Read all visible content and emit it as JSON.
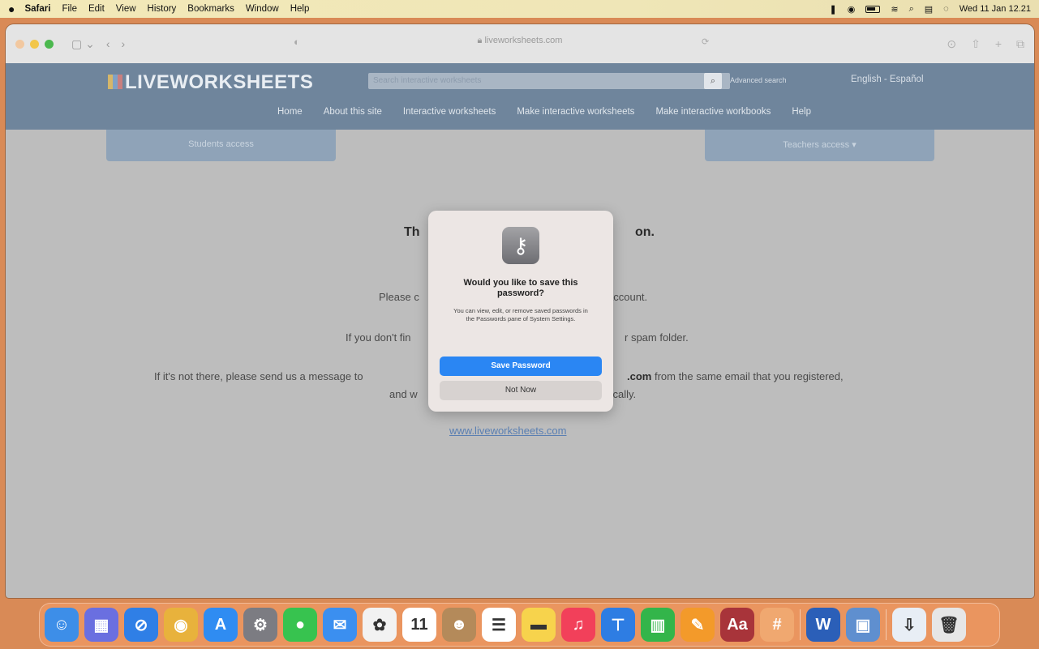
{
  "menubar": {
    "apple": "",
    "items": [
      "Safari",
      "File",
      "Edit",
      "View",
      "History",
      "Bookmarks",
      "Window",
      "Help"
    ],
    "clock": "Wed 11 Jan  12.21"
  },
  "browser": {
    "url": "liveworksheets.com"
  },
  "site": {
    "logo": "LIVEWORKSHEETS",
    "search_placeholder": "Search interactive worksheets",
    "advanced_search": "Advanced search",
    "language": "English - Español",
    "nav": [
      "Home",
      "About this site",
      "Interactive worksheets",
      "Make interactive worksheets",
      "Make interactive workbooks",
      "Help"
    ],
    "students_access": "Students access",
    "teachers_access": "Teachers access ▾"
  },
  "page": {
    "heading_start": "Th",
    "heading_end": "on.",
    "line1_start": "Please c",
    "line1_end": "account.",
    "line2_start": "If you don't fin",
    "line2_end": "r spam folder.",
    "line3_start": "If it's not there, please send us a message to",
    "line3_end_bold": ".com",
    "line3_end": " from the same email that you registered,",
    "line4_start": "and w",
    "line4_end": "tically.",
    "site_link": "www.liveworksheets.com"
  },
  "dialog": {
    "title": "Would you like to save this password?",
    "body": "You can view, edit, or remove saved passwords in the Passwords pane of System Settings.",
    "save_button": "Save Password",
    "not_now_button": "Not Now"
  },
  "dock": {
    "apps": [
      {
        "name": "finder",
        "color": "#3d8ee8",
        "glyph": "☺"
      },
      {
        "name": "launchpad",
        "color": "#6a6fe0",
        "glyph": "▦"
      },
      {
        "name": "safari",
        "color": "#2f7fe6",
        "glyph": "⊘"
      },
      {
        "name": "chrome",
        "color": "#e8b23c",
        "glyph": "◉"
      },
      {
        "name": "app-store",
        "color": "#2f8cf2",
        "glyph": "A"
      },
      {
        "name": "system-settings",
        "color": "#7c7c82",
        "glyph": "⚙"
      },
      {
        "name": "messages",
        "color": "#37c34f",
        "glyph": "●"
      },
      {
        "name": "mail",
        "color": "#3b8ff0",
        "glyph": "✉"
      },
      {
        "name": "photos",
        "color": "#f2f2f2",
        "glyph": "✿"
      },
      {
        "name": "calendar",
        "color": "#ffffff",
        "glyph": "11"
      },
      {
        "name": "contacts",
        "color": "#b48a5a",
        "glyph": "☻"
      },
      {
        "name": "reminders",
        "color": "#ffffff",
        "glyph": "☰"
      },
      {
        "name": "notes",
        "color": "#f7d34c",
        "glyph": "▬"
      },
      {
        "name": "music",
        "color": "#f2405a",
        "glyph": "♫"
      },
      {
        "name": "keynote",
        "color": "#2e7de3",
        "glyph": "⊤"
      },
      {
        "name": "numbers",
        "color": "#33b54a",
        "glyph": "▥"
      },
      {
        "name": "pages",
        "color": "#f39a2a",
        "glyph": "✎"
      },
      {
        "name": "dictionary",
        "color": "#a8343a",
        "glyph": "Aa"
      },
      {
        "name": "scribble",
        "color": "#f0a870",
        "glyph": "#"
      },
      {
        "name": "word",
        "color": "#2b5fb8",
        "glyph": "W"
      },
      {
        "name": "preview",
        "color": "#5f8fcf",
        "glyph": "▣"
      },
      {
        "name": "downloads",
        "color": "#e8eef5",
        "glyph": "⇩"
      },
      {
        "name": "trash",
        "color": "#e6e6e6",
        "glyph": "🗑"
      }
    ]
  }
}
